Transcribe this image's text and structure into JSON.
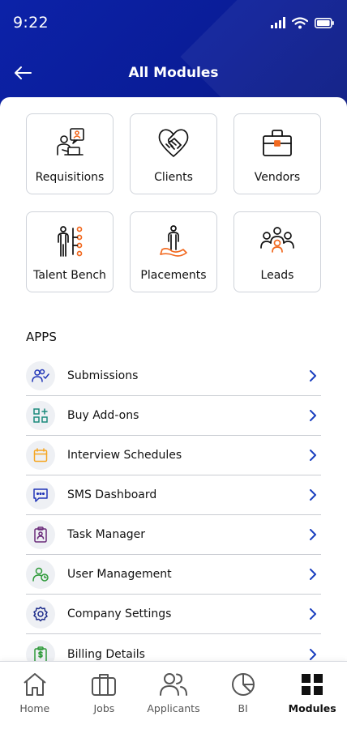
{
  "status": {
    "time": "9:22"
  },
  "header": {
    "title": "All Modules"
  },
  "modules": [
    {
      "label": "Requisitions",
      "icon": "requisitions-icon"
    },
    {
      "label": "Clients",
      "icon": "handshake-icon"
    },
    {
      "label": "Vendors",
      "icon": "briefcase-icon"
    },
    {
      "label": "Talent Bench",
      "icon": "talent-bench-icon"
    },
    {
      "label": "Placements",
      "icon": "placement-icon"
    },
    {
      "label": "Leads",
      "icon": "group-icon"
    }
  ],
  "apps": {
    "title": "APPS",
    "items": [
      {
        "label": "Submissions",
        "icon": "users-check-icon"
      },
      {
        "label": "Buy Add-ons",
        "icon": "add-grid-icon"
      },
      {
        "label": "Interview Schedules",
        "icon": "calendar-icon"
      },
      {
        "label": "SMS Dashboard",
        "icon": "chat-icon"
      },
      {
        "label": "Task Manager",
        "icon": "clipboard-user-icon"
      },
      {
        "label": "User Management",
        "icon": "user-clock-icon"
      },
      {
        "label": "Company Settings",
        "icon": "gear-icon"
      },
      {
        "label": "Billing Details",
        "icon": "billing-icon"
      }
    ]
  },
  "nav": [
    {
      "label": "Home",
      "icon": "home-icon"
    },
    {
      "label": "Jobs",
      "icon": "briefcase-icon"
    },
    {
      "label": "Applicants",
      "icon": "users-icon"
    },
    {
      "label": "BI",
      "icon": "pie-chart-icon"
    },
    {
      "label": "Modules",
      "icon": "grid-icon",
      "active": true
    }
  ],
  "colors": {
    "brand": "#0a1f9e",
    "accent_orange": "#f26a21",
    "chevron": "#1a3fbf"
  }
}
